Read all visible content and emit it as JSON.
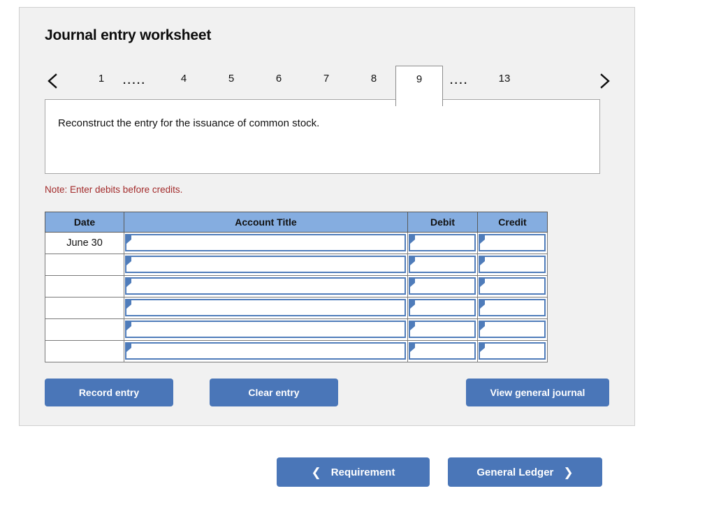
{
  "panel": {
    "title": "Journal entry worksheet"
  },
  "tabs": {
    "prev_icon": "chevron-left-icon",
    "next_icon": "chevron-right-icon",
    "items": [
      {
        "label": "1",
        "type": "page",
        "active": false
      },
      {
        "label": ".....",
        "type": "ellipsis",
        "active": false
      },
      {
        "label": "4",
        "type": "page",
        "active": false
      },
      {
        "label": "5",
        "type": "page",
        "active": false
      },
      {
        "label": "6",
        "type": "page",
        "active": false
      },
      {
        "label": "7",
        "type": "page",
        "active": false
      },
      {
        "label": "8",
        "type": "page",
        "active": false
      },
      {
        "label": "9",
        "type": "page",
        "active": true
      },
      {
        "label": "....",
        "type": "ellipsis",
        "active": false
      },
      {
        "label": "13",
        "type": "page",
        "active": false
      }
    ],
    "active_label": "9"
  },
  "prompt": {
    "text": "Reconstruct the entry for the issuance of common stock."
  },
  "note": {
    "text": "Note: Enter debits before credits."
  },
  "table": {
    "headers": {
      "date": "Date",
      "account_title": "Account Title",
      "debit": "Debit",
      "credit": "Credit"
    },
    "rows": [
      {
        "date": "June 30",
        "account_title": "",
        "debit": "",
        "credit": ""
      },
      {
        "date": "",
        "account_title": "",
        "debit": "",
        "credit": ""
      },
      {
        "date": "",
        "account_title": "",
        "debit": "",
        "credit": ""
      },
      {
        "date": "",
        "account_title": "",
        "debit": "",
        "credit": ""
      },
      {
        "date": "",
        "account_title": "",
        "debit": "",
        "credit": ""
      },
      {
        "date": "",
        "account_title": "",
        "debit": "",
        "credit": ""
      }
    ]
  },
  "actions": {
    "record_entry": "Record entry",
    "clear_entry": "Clear entry",
    "view_general_journal": "View general journal"
  },
  "footer": {
    "requirement": "Requirement",
    "general_ledger": "General Ledger",
    "prev_icon": "chevron-left-icon",
    "next_icon": "chevron-right-icon"
  },
  "colors": {
    "button_blue": "#4a76b8",
    "header_blue": "#85ade0",
    "input_border_blue": "#4f7cba",
    "note_red": "#a32c2c",
    "panel_bg": "#f1f1f1"
  }
}
